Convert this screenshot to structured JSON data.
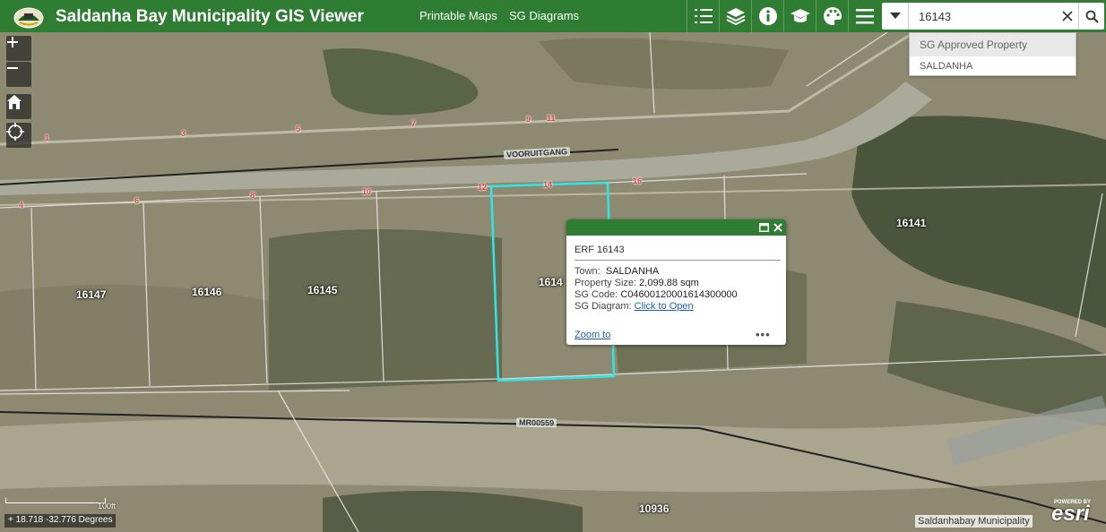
{
  "header": {
    "title": "Saldanha Bay Municipality GIS Viewer",
    "links": [
      "Printable Maps",
      "SG Diagrams"
    ]
  },
  "search": {
    "value": "16143",
    "suggestions": {
      "group": "SG Approved Property",
      "item": "SALDANHA"
    }
  },
  "map": {
    "parcel_numbers": [
      "1",
      "3",
      "5",
      "7",
      "9",
      "11",
      "4",
      "6",
      "8",
      "10",
      "12",
      "14",
      "16"
    ],
    "erf_labels": [
      "16147",
      "16146",
      "16145",
      "1614",
      "16141",
      "10936"
    ],
    "roads": [
      "VOORUITGANG",
      "MR00559"
    ],
    "scale_label": "100ft",
    "coordinates": "18.718 -32.776 Degrees",
    "attribution": "Saldanhabay Municipality",
    "esri_text": "esri",
    "esri_powered": "POWERED BY"
  },
  "popup": {
    "title": "ERF 16143",
    "town_label": "Town:",
    "town_value": "SALDANHA",
    "size_label": "Property Size:",
    "size_value": "2,099.88 sqm",
    "code_label": "SG Code:",
    "code_value": "C04600120001614300000",
    "diagram_label": "SG Diagram:",
    "diagram_link": "Click to Open",
    "zoom_link": "Zoom to",
    "more": "•••"
  },
  "colors": {
    "header": "#2e7d32",
    "selection": "#2ee6e6",
    "parcel_label": "#e04040"
  }
}
